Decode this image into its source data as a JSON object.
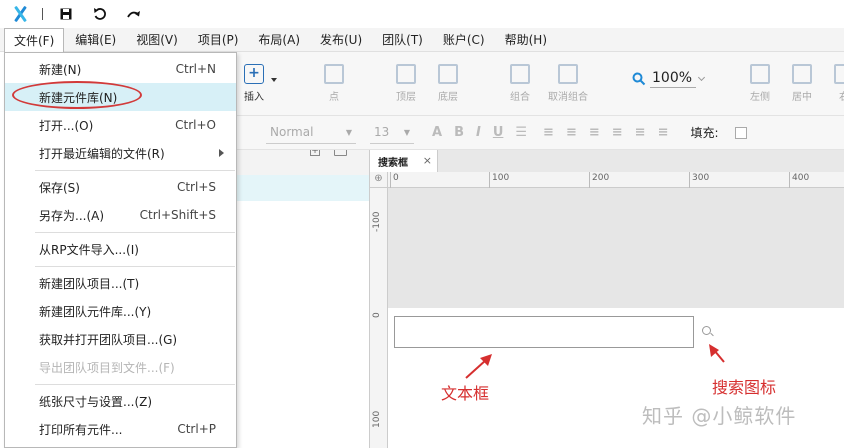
{
  "menubar": {
    "items": [
      "文件(F)",
      "编辑(E)",
      "视图(V)",
      "项目(P)",
      "布局(A)",
      "发布(U)",
      "团队(T)",
      "账户(C)",
      "帮助(H)"
    ]
  },
  "toolbar": {
    "insert_label": "插入",
    "point_label": "点",
    "top_label": "顶层",
    "bottom_label": "底层",
    "group_label": "组合",
    "ungroup_label": "取消组合",
    "left_label": "左侧",
    "center_label": "居中",
    "right_label": "右",
    "zoom": "100%"
  },
  "formatbar": {
    "style": "Normal",
    "size": "13",
    "fill_label": "填充:"
  },
  "file_menu": {
    "new": {
      "label": "新建(N)",
      "shortcut": "Ctrl+N"
    },
    "new_library": {
      "label": "新建元件库(N)"
    },
    "open": {
      "label": "打开...(O)",
      "shortcut": "Ctrl+O"
    },
    "recent": {
      "label": "打开最近编辑的文件(R)"
    },
    "save": {
      "label": "保存(S)",
      "shortcut": "Ctrl+S"
    },
    "save_as": {
      "label": "另存为...(A)",
      "shortcut": "Ctrl+Shift+S"
    },
    "import_rp": {
      "label": "从RP文件导入...(I)"
    },
    "new_team": {
      "label": "新建团队项目...(T)"
    },
    "new_team_lib": {
      "label": "新建团队元件库...(Y)"
    },
    "get_team": {
      "label": "获取并打开团队项目...(G)"
    },
    "export_team": {
      "label": "导出团队项目到文件...(F)"
    },
    "paper": {
      "label": "纸张尺寸与设置...(Z)"
    },
    "print": {
      "label": "打印所有元件...",
      "shortcut": "Ctrl+P"
    }
  },
  "canvas": {
    "tab_label": "搜索框",
    "tab_close": "×",
    "ruler_top": [
      "0",
      "100",
      "200",
      "300",
      "400"
    ],
    "ruler_left": [
      "-100",
      "0",
      "100"
    ],
    "annotation_textbox": "文本框",
    "annotation_search": "搜索图标"
  },
  "watermark": "知乎 @小鲸软件",
  "colors": {
    "accent": "#1f8ad6",
    "annotation": "#d62f2f",
    "highlight": "#d7f0f7"
  }
}
